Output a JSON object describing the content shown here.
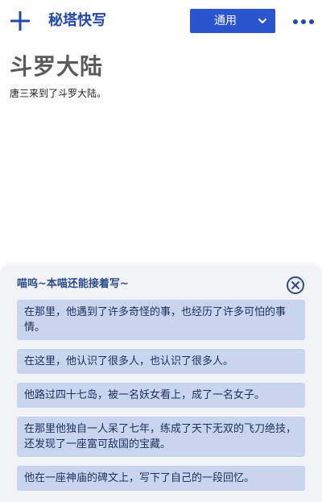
{
  "header": {
    "app_title": "秘塔快写",
    "mode_label": "通用"
  },
  "document": {
    "title": "斗罗大陆",
    "body": "唐三来到了斗罗大陆。"
  },
  "panel": {
    "header": "喵呜~本喵还能接着写~",
    "suggestions": [
      "在那里，他遇到了许多奇怪的事，也经历了许多可怕的事情。",
      "在这里，他认识了很多人，也认识了很多人。",
      "他路过四十七岛，被一名妖女看上，成了一名女子。",
      "在那里他独自一人呆了七年，练成了天下无双的飞刀绝技，还发现了一座富可敌国的宝藏。",
      "他在一座神庙的碑文上，写下了自己的一段回忆。"
    ]
  },
  "colors": {
    "brand": "#2349a8",
    "mode_button": "#2a55cf",
    "suggestion_bg": "#c9d5ee",
    "panel_bg": "#f1f3f7"
  },
  "icons": {
    "new": "plus-icon",
    "dropdown": "chevron-down-icon",
    "more": "more-dots-icon",
    "close": "close-circle-icon"
  }
}
